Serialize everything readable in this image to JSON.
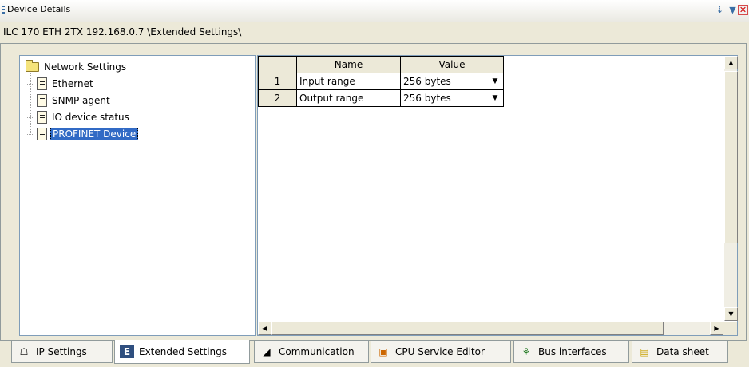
{
  "window": {
    "title": "Device Details",
    "path": "ILC 170 ETH 2TX 192.168.0.7 \\Extended Settings\\"
  },
  "tree": {
    "root": "Network Settings",
    "items": [
      "Ethernet",
      "SNMP agent",
      "IO device status",
      "PROFINET Device"
    ],
    "selected": "PROFINET Device"
  },
  "grid": {
    "headers": [
      "Name",
      "Value"
    ],
    "rows": [
      {
        "num": "1",
        "name": "Input range",
        "value": "256 bytes"
      },
      {
        "num": "2",
        "name": "Output range",
        "value": "256 bytes"
      }
    ]
  },
  "tabs": [
    {
      "label": "IP Settings",
      "icon": "network-icon"
    },
    {
      "label": "Extended Settings",
      "icon": "extended-settings-icon",
      "active": true
    },
    {
      "label": "Communication",
      "icon": "communication-icon"
    },
    {
      "label": "CPU Service Editor",
      "icon": "cpu-icon"
    },
    {
      "label": "Bus interfaces",
      "icon": "bus-icon"
    },
    {
      "label": "Data sheet",
      "icon": "datasheet-icon"
    }
  ]
}
